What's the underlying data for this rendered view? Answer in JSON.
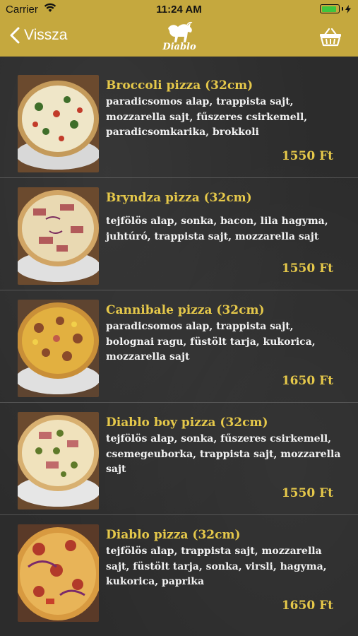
{
  "status_bar": {
    "carrier": "Carrier",
    "time": "11:24 AM"
  },
  "nav": {
    "back_label": "Vissza",
    "logo_text": "Diablo"
  },
  "colors": {
    "accent": "#c5a83e",
    "title": "#e5c84a",
    "text": "#f2f2f2",
    "background": "#2c2c2c"
  },
  "menu": {
    "items": [
      {
        "name": "Broccoli pizza (32cm)",
        "description": "paradicsomos alap, trappista sajt, mozzarella sajt, fűszeres csirkemell, paradicsomkarika, brokkoli",
        "price": "1550 Ft"
      },
      {
        "name": "Bryndza pizza (32cm)",
        "description": "tejfölös alap, sonka, bacon, lila hagyma, juhtúró, trappista sajt, mozzarella sajt",
        "price": "1550 Ft"
      },
      {
        "name": "Cannibale pizza (32cm)",
        "description": "paradicsomos alap, trappista sajt, bolognai ragu, füstölt tarja, kukorica, mozzarella sajt",
        "price": "1650 Ft"
      },
      {
        "name": "Diablo boy pizza (32cm)",
        "description": "tejfölös alap, sonka, fűszeres csirkemell, csemegeuborka, trappista sajt, mozzarella sajt",
        "price": "1550 Ft"
      },
      {
        "name": "Diablo pizza (32cm)",
        "description": "tejfölös alap, trappista sajt, mozzarella sajt, füstölt tarja, sonka, virsli, hagyma, kukorica, paprika",
        "price": "1650 Ft"
      }
    ]
  }
}
